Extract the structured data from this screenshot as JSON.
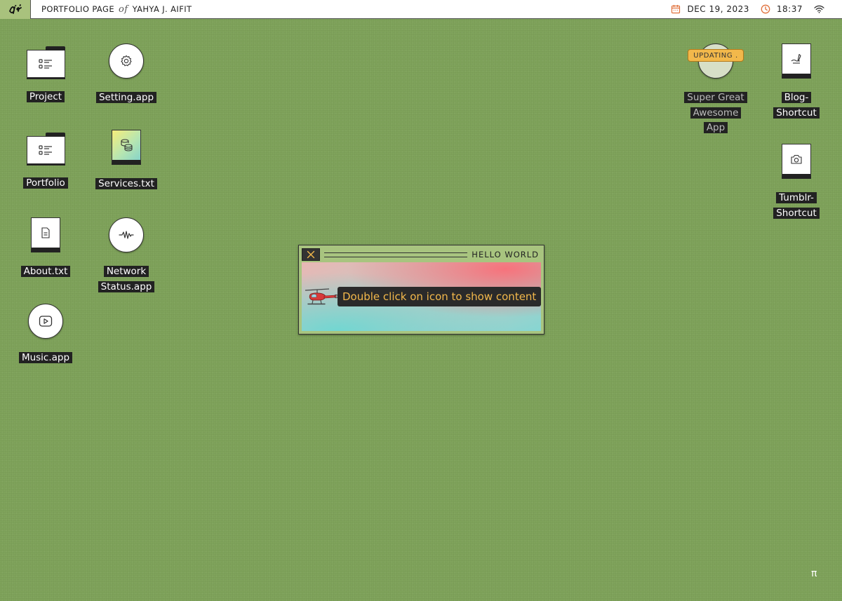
{
  "topbar": {
    "title_pre": "PORTFOLIO PAGE",
    "title_of": "of",
    "title_name": "YAHYA J. AIFIT",
    "date": "DEC 19, 2023",
    "time": "18:37",
    "logo_icon": "signature-logo-icon",
    "date_icon": "calendar-icon",
    "time_icon": "clock-icon",
    "wifi_icon": "wifi-icon"
  },
  "desktop": {
    "project": "Project",
    "setting": "Setting.app",
    "portfolio": "Portfolio",
    "services": "Services.txt",
    "about": "About.txt",
    "network_line1": "Network",
    "network_line2": "Status.app",
    "music": "Music.app",
    "super_line1": "Super Great",
    "super_line2": "Awesome",
    "super_line3": "App",
    "updating": "UPDATING .",
    "blog_line1": "Blog-",
    "blog_line2": "Shortcut",
    "tumblr_line1": "Tumblr-",
    "tumblr_line2": "Shortcut"
  },
  "window": {
    "title": "HELLO WORLD",
    "message": "Double click on icon to show content"
  },
  "footer": {
    "pi": "π"
  },
  "colors": {
    "desktop_bg": "#7fa35b",
    "accent": "#a9c27d",
    "badge": "#f2b84b",
    "label_bg": "#222222"
  }
}
